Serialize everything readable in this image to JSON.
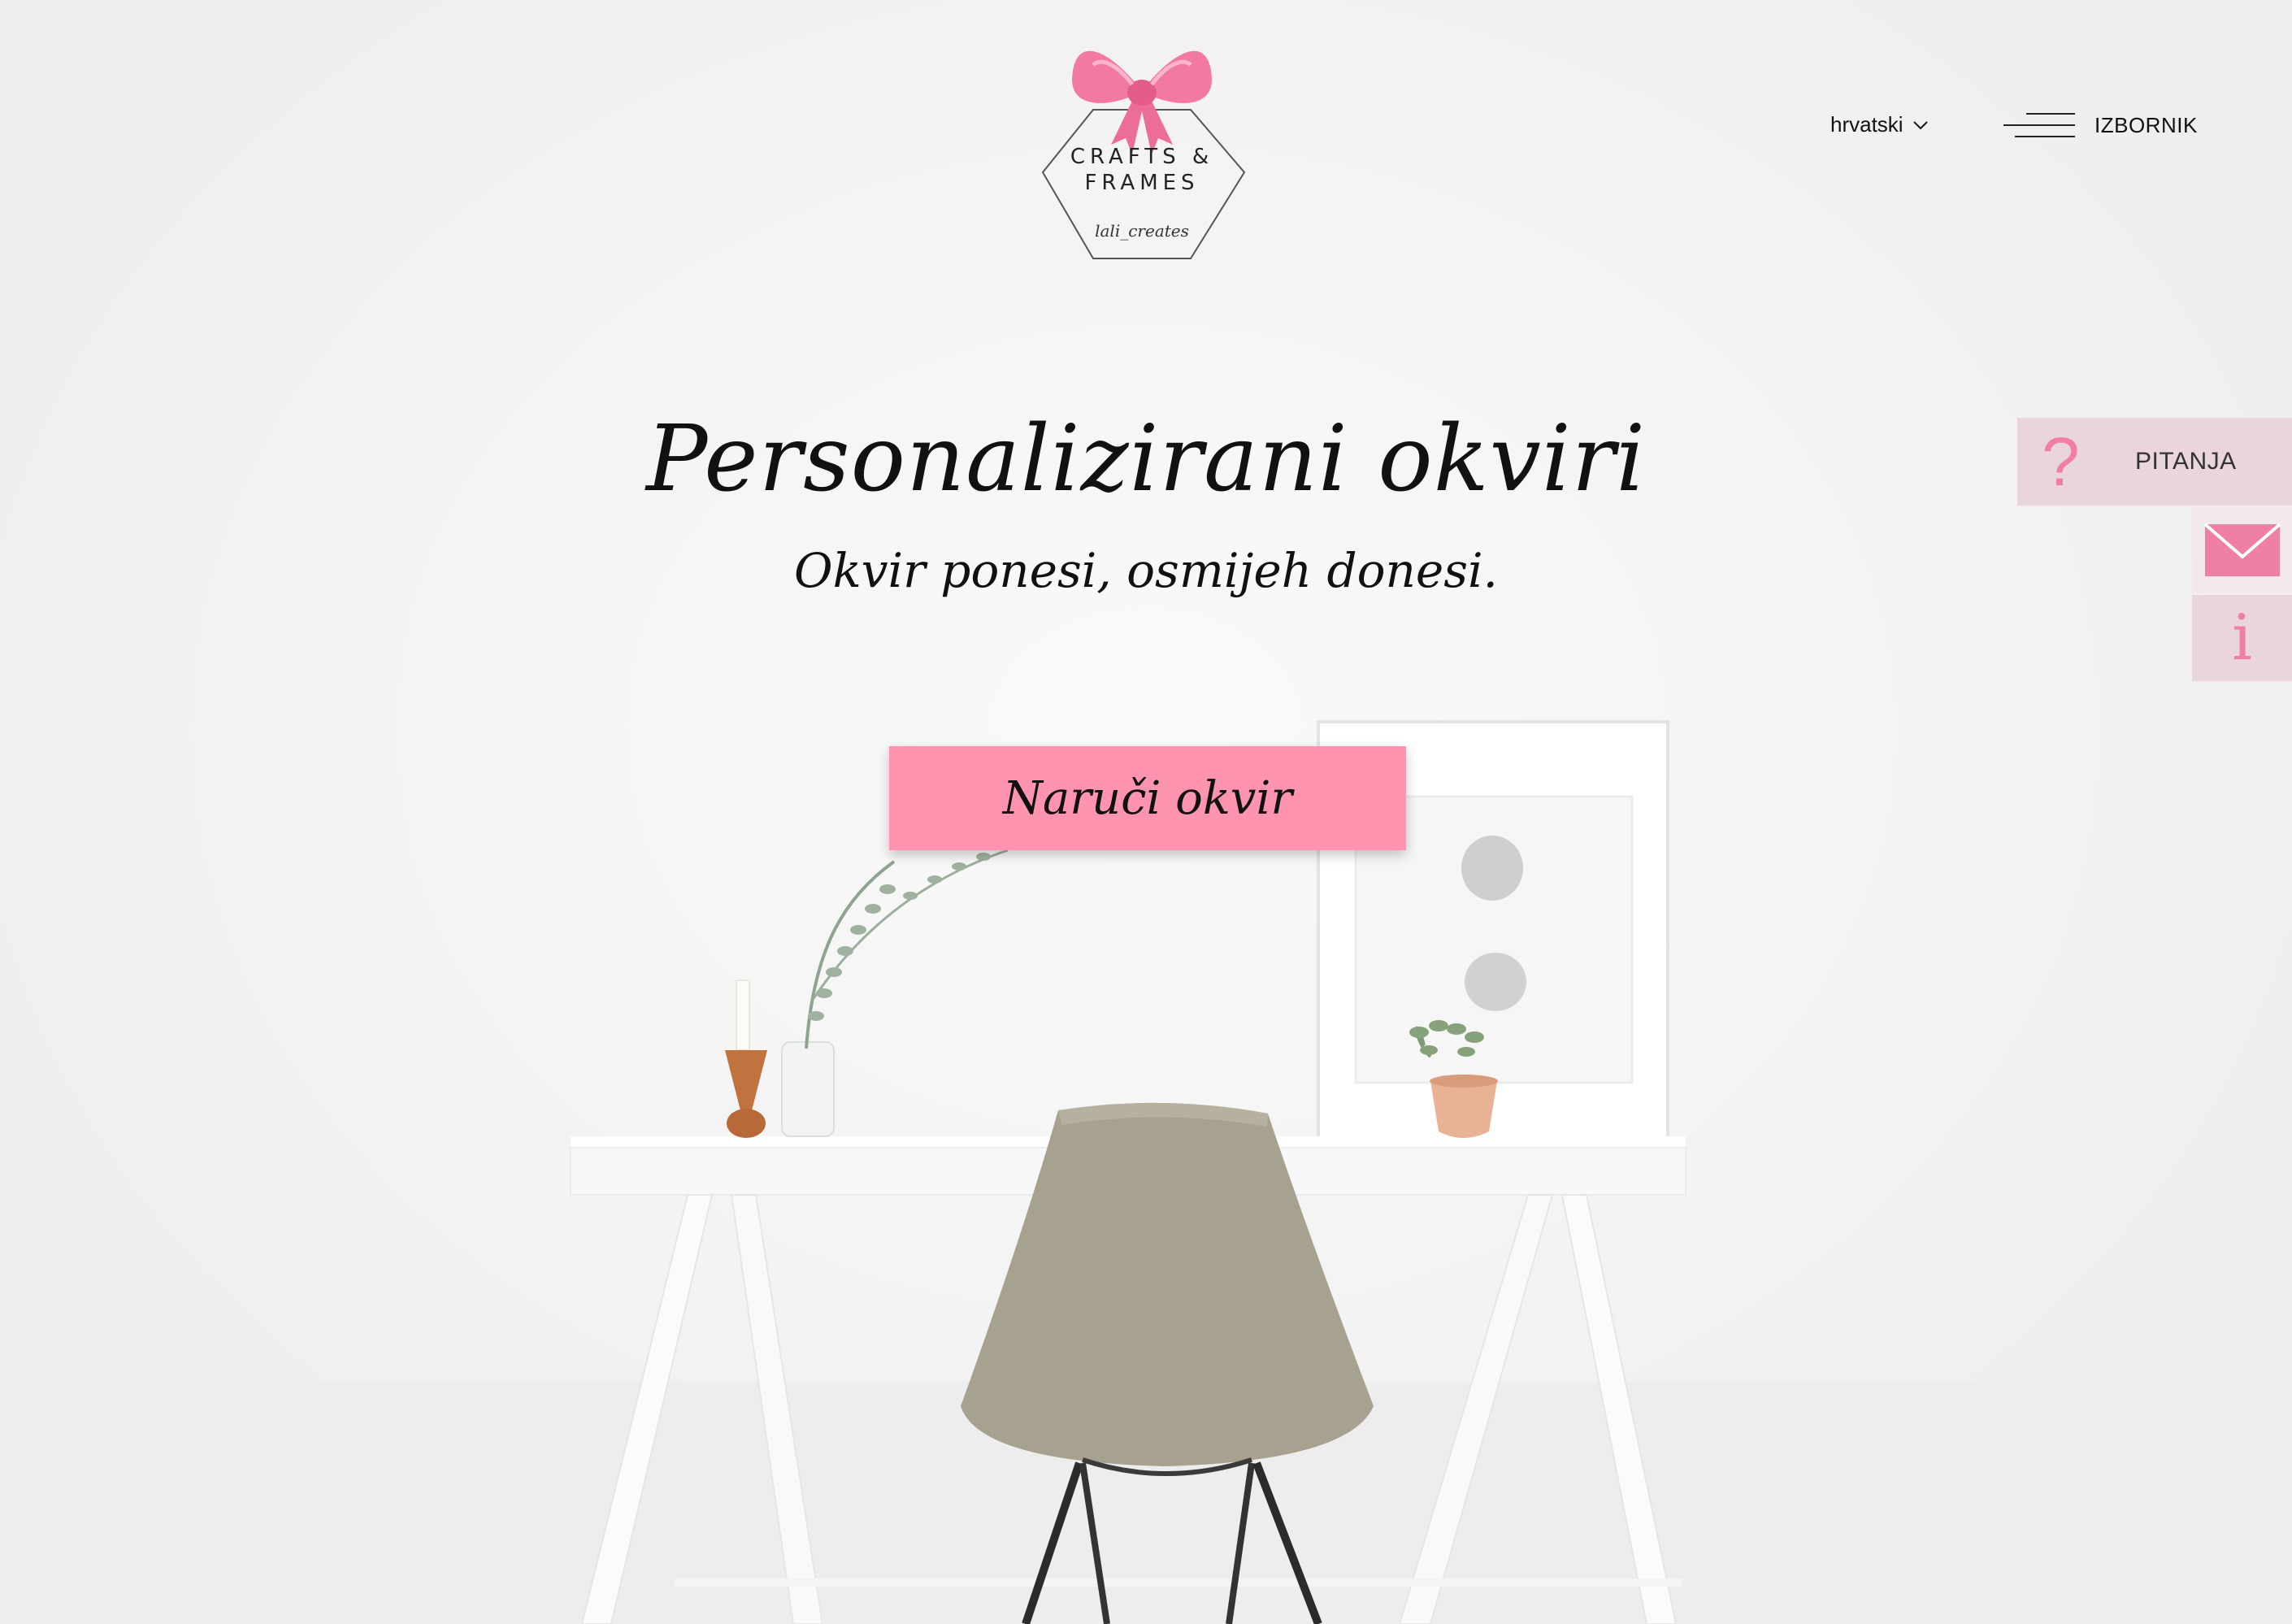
{
  "brand": {
    "line1": "CRAFTS &",
    "line2": "FRAMES",
    "handle": "lali_creates"
  },
  "nav": {
    "language": "hrvatski",
    "menu_label": "IZBORNIK"
  },
  "hero": {
    "title": "Personalizirani okviri",
    "tagline": "Okvir ponesi, osmijeh donesi.",
    "cta_label": "Naruči okvir"
  },
  "side": {
    "faq_icon": "?",
    "faq_label": "PITANJA",
    "mail_icon": "envelope-icon",
    "info_icon": "i"
  },
  "colors": {
    "accent": "#ff94b0",
    "accent_text": "#ef7fa3",
    "side_panel": "#ead6da"
  }
}
